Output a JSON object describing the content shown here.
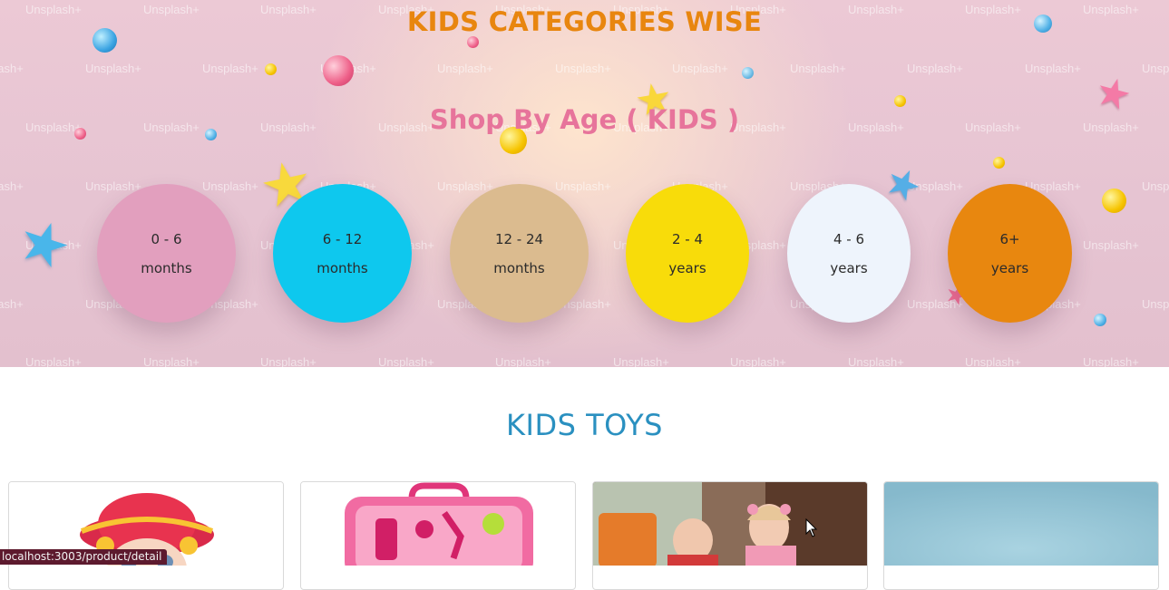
{
  "hero": {
    "title": "KIDS CATEGORIES WISE",
    "subtitle": "Shop By Age ( KIDS )",
    "watermark": "Unsplash+",
    "age_groups": [
      {
        "line1": "0 - 6",
        "line2": "months",
        "color": "#e29fbe"
      },
      {
        "line1": "6 - 12",
        "line2": "months",
        "color": "#0ec8ee"
      },
      {
        "line1": "12 - 24",
        "line2": "months",
        "color": "#dbbb8f"
      },
      {
        "line1": "2 - 4",
        "line2": "years",
        "color": "#f8dc0a"
      },
      {
        "line1": "4 - 6",
        "line2": "years",
        "color": "#eef4fc"
      },
      {
        "line1": "6+",
        "line2": "years",
        "color": "#e8870f"
      }
    ]
  },
  "toys": {
    "title": "KIDS TOYS",
    "cards": [
      {
        "image": "doll-with-red-hat"
      },
      {
        "image": "pink-doctor-play-set"
      },
      {
        "image": "children-playing-photo"
      },
      {
        "image": "blue-toy-photo"
      }
    ]
  },
  "status_bar": {
    "url": "localhost:3003/product/detail"
  }
}
